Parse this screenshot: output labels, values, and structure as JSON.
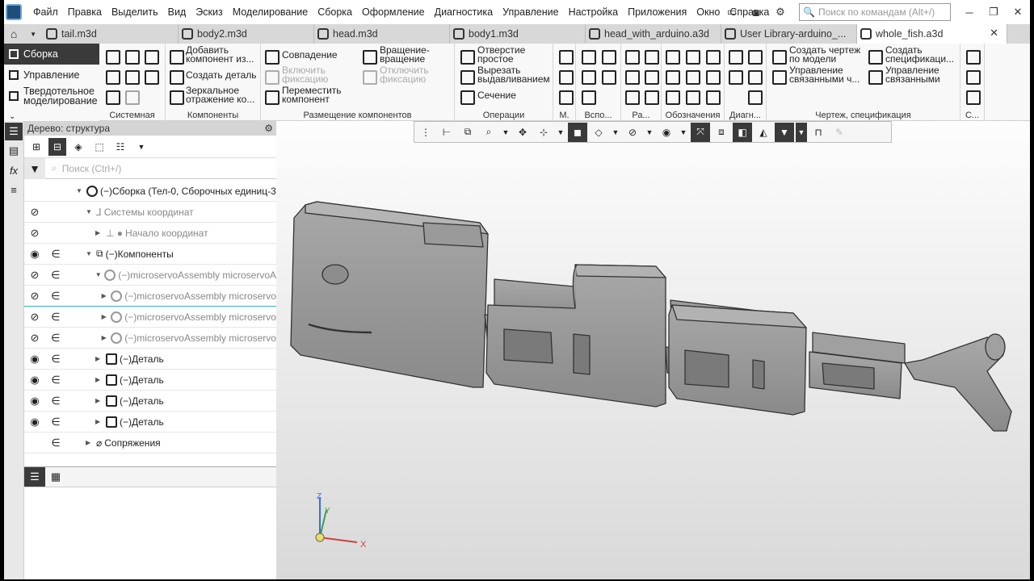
{
  "menu": [
    "Файл",
    "Правка",
    "Выделить",
    "Вид",
    "Эскиз",
    "Моделирование",
    "Сборка",
    "Оформление",
    "Диагностика",
    "Управление",
    "Настройка",
    "Приложения",
    "Окно",
    "Справка"
  ],
  "command_search_placeholder": "Поиск по командам (Alt+/)",
  "tabs": [
    "tail.m3d",
    "body2.m3d",
    "head.m3d",
    "body1.m3d",
    "head_with_arduino.a3d",
    "User Library-arduino_...",
    "whole_fish.a3d"
  ],
  "modes": [
    "Сборка",
    "Управление",
    "Твердотельное моделирование"
  ],
  "ribbon": {
    "groups": [
      "Системная",
      "Компоненты",
      "Размещение компонентов",
      "Операции",
      "М.",
      "Вспо...",
      "Ра...",
      "Обозначения",
      "Диагн...",
      "Чертеж, спецификация",
      "С..."
    ],
    "components": [
      "Добавить компонент из...",
      "Создать деталь",
      "Зеркальное отражение ко..."
    ],
    "placement": [
      "Совпадение",
      "Включить фиксацию",
      "Переместить компонент",
      "Вращение-вращение",
      "Отключить фиксацию"
    ],
    "operations": [
      "Отверстие простое",
      "Вырезать выдавливанием",
      "Сечение"
    ],
    "drawing": [
      "Создать чертеж по модели",
      "Управление связанными ч...",
      "Создать спецификаци...",
      "Управление связанными сп..."
    ]
  },
  "tree": {
    "title": "Дерево: структура",
    "search_placeholder": "Поиск (Ctrl+/)",
    "rows": [
      "(−)Сборка (Тел-0, Сборочных единиц-3",
      "Системы координат",
      "Начало координат",
      "(−)Компоненты",
      "(−)microservoAssembly microservoA",
      "(−)microservoAssembly microservo",
      "(−)microservoAssembly microservo",
      "(−)microservoAssembly microservo",
      "(−)Деталь",
      "(−)Деталь",
      "(−)Деталь",
      "(−)Деталь",
      "Сопряжения"
    ]
  },
  "triad": {
    "z": "Z",
    "y": "Y",
    "x": "X"
  }
}
